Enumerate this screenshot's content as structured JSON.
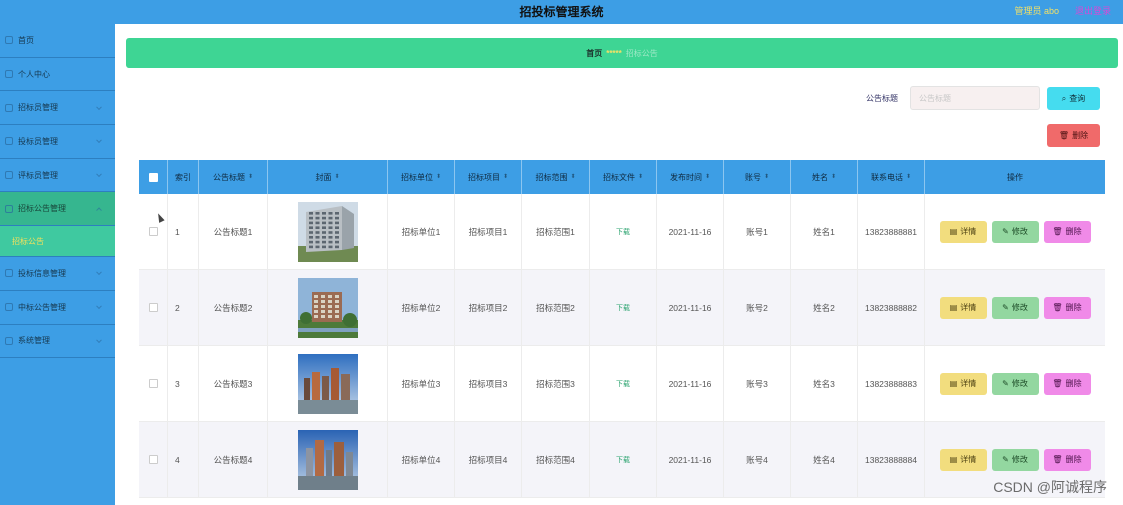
{
  "app": {
    "title": "招投标管理系统",
    "admin_label": "管理员 abo",
    "logout_label": "退出登录"
  },
  "sidebar": {
    "items": [
      {
        "label": "首页"
      },
      {
        "label": "个人中心"
      },
      {
        "label": "招标员管理"
      },
      {
        "label": "投标员管理"
      },
      {
        "label": "评标员管理"
      },
      {
        "label": "招标公告管理"
      },
      {
        "label": "投标信息管理"
      },
      {
        "label": "中标公告管理"
      },
      {
        "label": "系统管理"
      }
    ],
    "active_sub": "招标公告"
  },
  "breadcrumb": {
    "home": "首页",
    "sep": "*****",
    "current": "招标公告"
  },
  "search": {
    "label": "公告标题",
    "placeholder": "公告标题",
    "button": "查询"
  },
  "toolbar": {
    "delete": "删除"
  },
  "table": {
    "headers": [
      "索引",
      "公告标题",
      "封面",
      "招标单位",
      "招标项目",
      "招标范围",
      "招标文件",
      "发布时间",
      "账号",
      "姓名",
      "联系电话",
      "操作"
    ],
    "download_label": "下载",
    "actions": {
      "detail": "详情",
      "edit": "修改",
      "delete": "删除"
    },
    "rows": [
      {
        "index": "1",
        "title": "公告标题1",
        "unit": "招标单位1",
        "project": "招标项目1",
        "scope": "招标范围1",
        "date": "2021-11-16",
        "account": "账号1",
        "name": "姓名1",
        "phone": "13823888881"
      },
      {
        "index": "2",
        "title": "公告标题2",
        "unit": "招标单位2",
        "project": "招标项目2",
        "scope": "招标范围2",
        "date": "2021-11-16",
        "account": "账号2",
        "name": "姓名2",
        "phone": "13823888882"
      },
      {
        "index": "3",
        "title": "公告标题3",
        "unit": "招标单位3",
        "project": "招标项目3",
        "scope": "招标范围3",
        "date": "2021-11-16",
        "account": "账号3",
        "name": "姓名3",
        "phone": "13823888883"
      },
      {
        "index": "4",
        "title": "公告标题4",
        "unit": "招标单位4",
        "project": "招标项目4",
        "scope": "招标范围4",
        "date": "2021-11-16",
        "account": "账号4",
        "name": "姓名4",
        "phone": "13823888884"
      }
    ]
  },
  "watermark": "CSDN @阿诚程序"
}
